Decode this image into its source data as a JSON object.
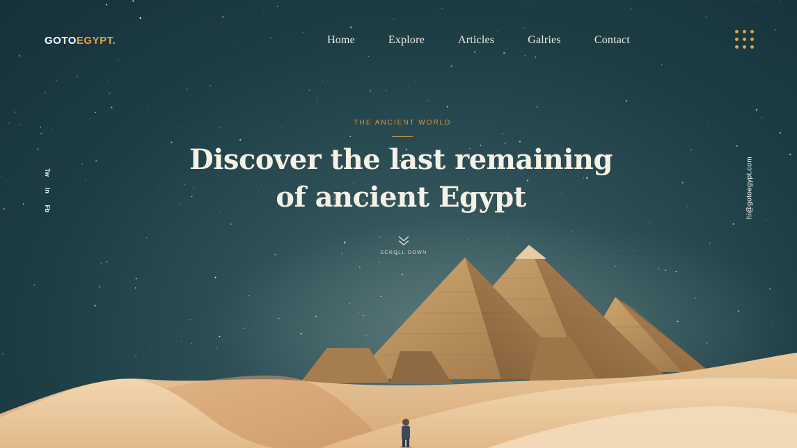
{
  "logo": {
    "text_main": "GOTO",
    "text_accent": "EGYPT."
  },
  "nav": {
    "items": [
      {
        "label": "Home"
      },
      {
        "label": "Explore"
      },
      {
        "label": "Articles"
      },
      {
        "label": "Galries"
      },
      {
        "label": "Contact"
      }
    ]
  },
  "menu": {
    "icon": "grid-dots-icon",
    "accent_color": "#e0a24a"
  },
  "social": {
    "items": [
      {
        "icon": "twitter-icon",
        "glyph": "Tw"
      },
      {
        "icon": "instagram-icon",
        "glyph": "In"
      },
      {
        "icon": "facebook-icon",
        "glyph": "Fb"
      }
    ]
  },
  "contact": {
    "email": "hi@gotoegypt.com"
  },
  "hero": {
    "eyebrow": "THE ANCIENT WORLD",
    "headline_line1": "Discover the last remaining",
    "headline_line2": "of ancient Egypt",
    "scroll_label": "SCROLL DOWN",
    "scroll_icon": "double-chevron-down-icon"
  },
  "colors": {
    "accent": "#e0a24a",
    "sky": "#1d3d44",
    "sand": "#e7c49a"
  }
}
